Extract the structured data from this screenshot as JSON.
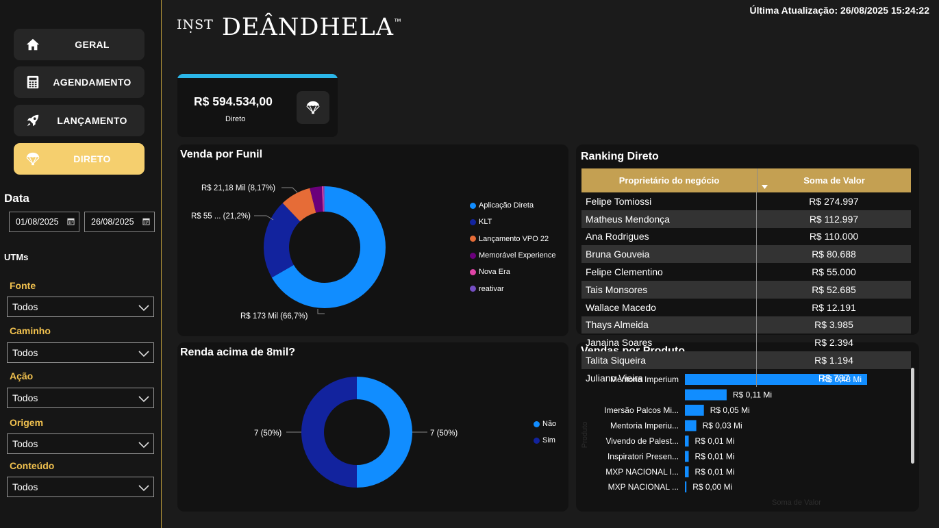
{
  "nav": [
    {
      "label": "GERAL",
      "icon": "home-icon",
      "active": false
    },
    {
      "label": "AGENDAMENTO",
      "icon": "calculator-icon",
      "active": false
    },
    {
      "label": "LANÇAMENTO",
      "icon": "rocket-icon",
      "active": false
    },
    {
      "label": "DIRETO",
      "icon": "parachute-icon",
      "active": true
    }
  ],
  "filters": {
    "date_title": "Data",
    "date_start": "01/08/2025",
    "date_end": "26/08/2025",
    "utm_title": "UTMs",
    "items": [
      {
        "label": "Fonte",
        "value": "Todos"
      },
      {
        "label": "Caminho",
        "value": "Todos"
      },
      {
        "label": "Ação",
        "value": "Todos"
      },
      {
        "label": "Origem",
        "value": "Todos"
      },
      {
        "label": "Conteúdo",
        "value": "Todos"
      }
    ]
  },
  "header": {
    "logo_prefix": "INST",
    "logo_name": "DEÂNDHELA",
    "logo_tm": "™",
    "last_update": "Última Atualização: 26/08/2025 15:24:22"
  },
  "kpi": {
    "value": "R$ 594.534,00",
    "label": "Direto",
    "icon": "parachute-icon",
    "accent": "#2bb6e8"
  },
  "chart_data": [
    {
      "type": "pie",
      "title": "Venda por Funil",
      "categories": [
        "Aplicação Direta",
        "KLT",
        "Lançamento VPO 22",
        "Memorável Experience",
        "Nova Era",
        "reativar"
      ],
      "values": [
        66.7,
        21.2,
        8.17,
        3.2,
        0.4,
        0.33
      ],
      "colors": [
        "#118dff",
        "#12239e",
        "#e66c37",
        "#6b007b",
        "#e044a7",
        "#744ec2"
      ],
      "data_labels": [
        "R$ 173 Mil (66,7%)",
        "R$ 55 ... (21,2%)",
        "R$ 21,18 Mil (8,17%)"
      ]
    },
    {
      "type": "pie",
      "title": "Renda acima de 8mil?",
      "categories": [
        "Não",
        "Sim"
      ],
      "values": [
        7,
        7
      ],
      "colors": [
        "#118dff",
        "#12239e"
      ],
      "data_labels": [
        "7 (50%)",
        "7 (50%)"
      ]
    },
    {
      "type": "bar",
      "title": "Vendas por Produto",
      "xlabel": "Soma de Valor",
      "ylabel": "Produto",
      "categories": [
        "Mentoria Imperium",
        "",
        "Imersão Palcos Mi...",
        "Mentoria Imperiu...",
        "Vivendo de Palest...",
        "Inspiratori Presen...",
        "MXP NACIONAL I...",
        "MXP NACIONAL ..."
      ],
      "values": [
        0.48,
        0.11,
        0.05,
        0.03,
        0.01,
        0.01,
        0.01,
        0.004
      ],
      "data_labels": [
        "R$ 0,48 Mi",
        "R$ 0,11 Mi",
        "R$ 0,05 Mi",
        "R$ 0,03 Mi",
        "R$ 0,01 Mi",
        "R$ 0,01 Mi",
        "R$ 0,01 Mi",
        "R$ 0,00 Mi"
      ],
      "colors": [
        "#118dff"
      ]
    }
  ],
  "ranking": {
    "title": "Ranking Direto",
    "columns": [
      "Proprietário do negócio",
      "Soma de Valor"
    ],
    "rows": [
      [
        "Felipe Tomiossi",
        "R$ 274.997"
      ],
      [
        "Matheus Mendonça",
        "R$ 112.997"
      ],
      [
        "Ana Rodrigues",
        "R$ 110.000"
      ],
      [
        "Bruna Gouveia",
        "R$ 80.688"
      ],
      [
        "Felipe Clementino",
        "R$ 55.000"
      ],
      [
        "Tais Monsores",
        "R$ 52.685"
      ],
      [
        "Wallace Macedo",
        "R$ 12.191"
      ],
      [
        "Thays Almeida",
        "R$ 3.985"
      ],
      [
        "Janaina Soares",
        "R$ 2.394"
      ],
      [
        "Talita Siqueira",
        "R$ 1.194"
      ],
      [
        "Juliano Vieira",
        "R$ 787"
      ]
    ]
  }
}
